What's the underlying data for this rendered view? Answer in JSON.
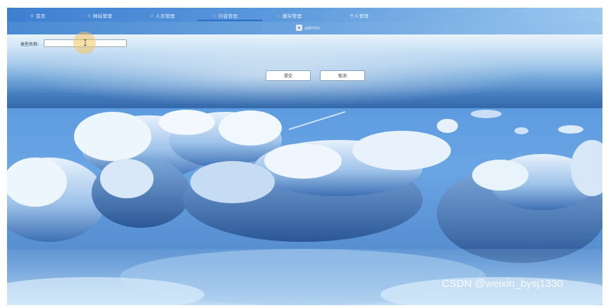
{
  "nav": {
    "items": [
      {
        "label": "首页",
        "icon": "home-icon"
      },
      {
        "label": "网站管理",
        "icon": "site-icon"
      },
      {
        "label": "人员管理",
        "icon": "user-icon"
      },
      {
        "label": "内容管理",
        "icon": "content-icon",
        "active": true
      },
      {
        "label": "模块管理",
        "icon": "module-icon"
      },
      {
        "label": "个人管理",
        "icon": "profile-icon"
      }
    ]
  },
  "user": {
    "name": "admin",
    "icon": "avatar-icon"
  },
  "form": {
    "type_label": "类型名称:",
    "type_value": "",
    "submit_label": "提交",
    "cancel_label": "取消"
  },
  "watermark": "CSDN @weixin_bysj1330",
  "colors": {
    "nav_bg": "#4b8ad2",
    "active_underline": "#2d6fc4",
    "button_bg": "#ffffff"
  }
}
